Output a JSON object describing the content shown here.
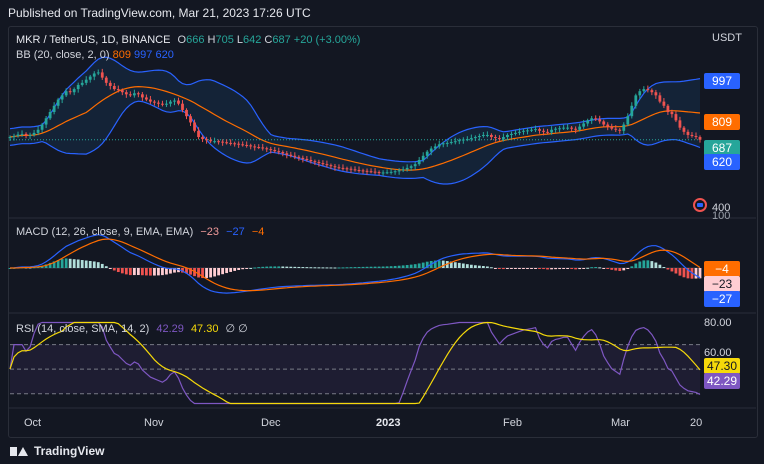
{
  "header": {
    "published": "Published on TradingView.com, Mar 21, 2023 17:26 UTC"
  },
  "footer": {
    "brand": "TradingView"
  },
  "colors": {
    "bg": "#131722",
    "up": "#26a69a",
    "down": "#ef5350",
    "bb_band": "#2962ff",
    "bb_basis": "#ff6d00",
    "macd": "#2962ff",
    "signal": "#ff6d00",
    "rsi": "#7e57c2",
    "rsi_sma": "#f5d90a",
    "price_line": "#26a69a"
  },
  "legend": {
    "symbol": "MKR / TetherUS, 1D, BINANCE",
    "o_label": "O",
    "o_val": "666",
    "h_label": "H",
    "h_val": "705",
    "l_label": "L",
    "l_val": "642",
    "c_label": "C",
    "c_val": "687",
    "change": "+20 (+3.00%)",
    "bb_name": "BB (20, close, 2, 0)",
    "bb_basis": "809",
    "bb_upper": "997",
    "bb_lower": "620",
    "macd_name": "MACD (12, 26, close, 9, EMA, EMA)",
    "macd_hist": "−23",
    "macd_line": "−27",
    "macd_signal": "−4",
    "rsi_name": "RSI (14, close, SMA, 14, 2)",
    "rsi_val": "42.29",
    "rsi_sma": "47.30",
    "rsi_extra": "∅ ∅"
  },
  "axis": {
    "price_unit": "USDT",
    "price_tick": "400",
    "macd_tick": "100",
    "rsi_ticks": [
      "80.00",
      "60.00"
    ],
    "x_labels": [
      "Oct",
      "Nov",
      "Dec",
      "2023",
      "Feb",
      "Mar",
      "20"
    ]
  },
  "badges": {
    "price": [
      "997",
      "809",
      "687",
      "620"
    ],
    "macd": [
      "−4",
      "−23",
      "−27"
    ],
    "rsi": [
      "47.30",
      "42.29"
    ]
  },
  "chart_data": [
    {
      "type": "candlestick",
      "title": "MKR / TetherUS, 1D, BINANCE",
      "ylabel": "USDT",
      "x_range": [
        "2022-09-22",
        "2023-03-21"
      ],
      "ylim": [
        350,
        1060
      ],
      "close_series": {
        "step_days": 1,
        "start": "2022-09-22",
        "values": [
          700,
          705,
          712,
          715,
          708,
          710,
          720,
          735,
          760,
          790,
          820,
          850,
          880,
          900,
          920,
          915,
          930,
          950,
          960,
          975,
          990,
          1005,
          1010,
          985,
          960,
          945,
          930,
          925,
          915,
          905,
          900,
          910,
          905,
          890,
          880,
          870,
          865,
          860,
          855,
          860,
          870,
          875,
          860,
          830,
          800,
          770,
          730,
          700,
          690,
          685,
          680,
          680,
          678,
          675,
          672,
          670,
          668,
          665,
          662,
          660,
          655,
          652,
          650,
          646,
          642,
          638,
          632,
          628,
          622,
          615,
          610,
          605,
          600,
          595,
          590,
          584,
          580,
          575,
          570,
          565,
          560,
          555,
          552,
          550,
          548,
          545,
          542,
          540,
          538,
          536,
          534,
          532,
          530,
          530,
          531,
          533,
          536,
          540,
          545,
          552,
          560,
          570,
          590,
          610,
          630,
          645,
          655,
          665,
          670,
          672,
          676,
          680,
          685,
          688,
          690,
          695,
          700,
          705,
          710,
          710,
          700,
          695,
          690,
          700,
          710,
          715,
          720,
          725,
          730,
          732,
          735,
          738,
          730,
          725,
          722,
          735,
          740,
          742,
          745,
          745,
          740,
          735,
          750,
          765,
          780,
          790,
          785,
          775,
          760,
          750,
          740,
          735,
          730,
          760,
          800,
          850,
          900,
          920,
          930,
          925,
          915,
          900,
          870,
          850,
          820,
          810,
          780,
          745,
          725,
          710,
          705,
          700,
          687
        ]
      },
      "bollinger": {
        "period": 20,
        "stddev": 2,
        "last": {
          "upper": 997,
          "basis": 809,
          "lower": 620
        }
      },
      "last": {
        "open": 666,
        "high": 705,
        "low": 642,
        "close": 687,
        "change": "+20 (+3.00%)"
      }
    },
    {
      "type": "bar",
      "title": "MACD (12, 26, close, 9, EMA, EMA)",
      "series": [
        {
          "name": "Histogram",
          "last": -23
        },
        {
          "name": "MACD",
          "last": -27
        },
        {
          "name": "Signal",
          "last": -4
        }
      ]
    },
    {
      "type": "line",
      "title": "RSI (14, close, SMA, 14, 2)",
      "ylim": [
        20,
        90
      ],
      "bands": [
        70,
        50,
        30
      ],
      "series": [
        {
          "name": "RSI",
          "last": 42.29
        },
        {
          "name": "SMA",
          "last": 47.3
        }
      ]
    }
  ]
}
